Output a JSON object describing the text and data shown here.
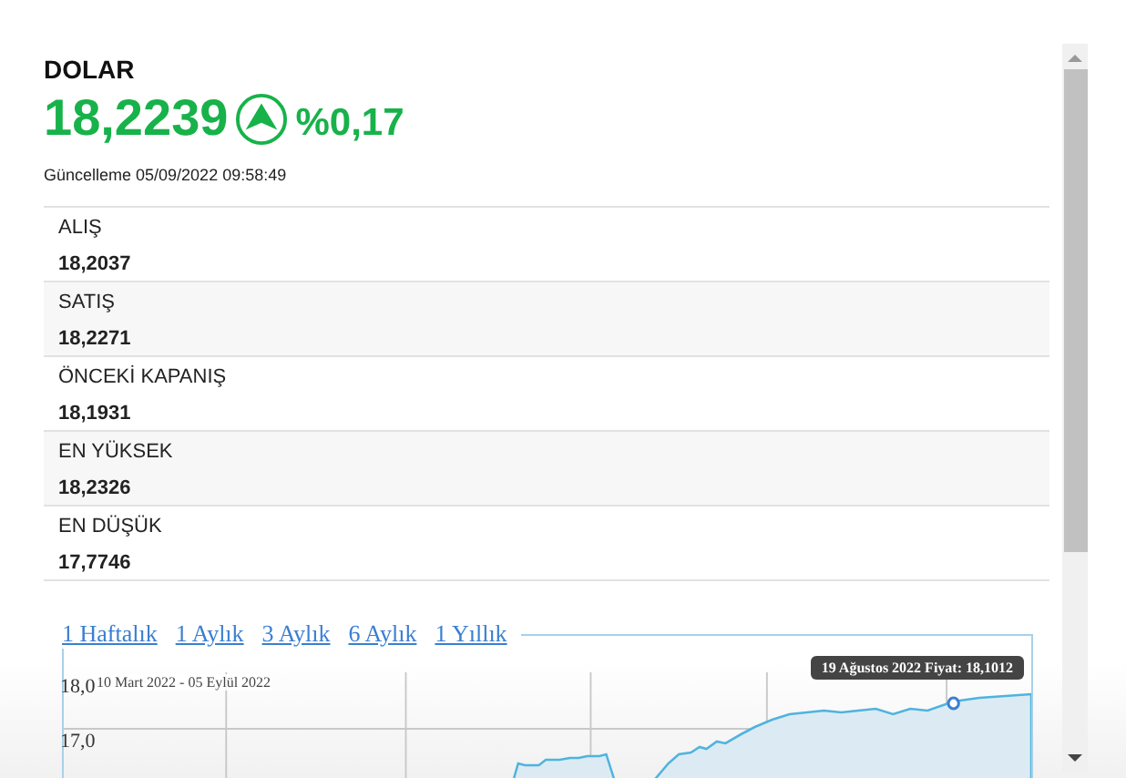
{
  "currency": {
    "name": "DOLAR",
    "price": "18,2239",
    "rising": true,
    "change": "%0,17",
    "updated": "Güncelleme 05/09/2022 09:58:49"
  },
  "rows": [
    {
      "label": "ALIŞ",
      "value": "18,2037"
    },
    {
      "label": "SATIŞ",
      "value": "18,2271"
    },
    {
      "label": "ÖNCEKİ KAPANIŞ",
      "value": "18,1931"
    },
    {
      "label": "EN YÜKSEK",
      "value": "18,2326"
    },
    {
      "label": "EN DÜŞÜK",
      "value": "17,7746"
    }
  ],
  "chart": {
    "periods": [
      "1 Haftalık",
      "1 Aylık",
      "3 Aylık",
      "6 Aylık",
      "1 Yıllık"
    ],
    "range": "10 Mart 2022 - 05 Eylül 2022",
    "tooltip": "19 Ağustos 2022 Fiyat: 18,1012",
    "y_labels": [
      "18,0",
      "17,0"
    ]
  }
}
